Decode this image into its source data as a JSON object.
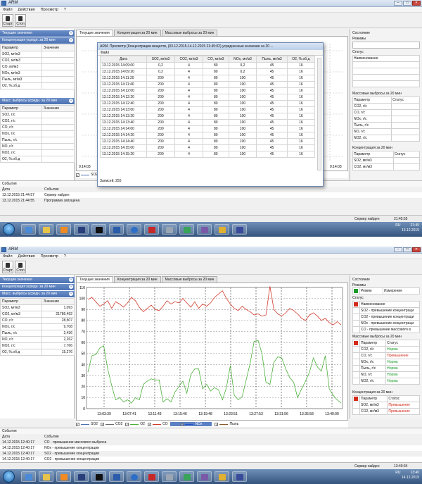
{
  "app": {
    "title": "ARM"
  },
  "menu": [
    "Файл",
    "Действия",
    "Просмотр",
    "?"
  ],
  "toolbar": {
    "start": "Старт",
    "stop": "Стоп"
  },
  "left": {
    "current_values": "Текущие значения",
    "conc_20": "Концентрация усредн. за 20 мин",
    "mass_20": "Масс. выбросы усредн. за 20 мин",
    "param_header": "Параметр",
    "value_header": "Значение"
  },
  "tabs": [
    "Текущие значения",
    "Концентрация за 20 мин",
    "Массовые выбросы за 20 мин"
  ],
  "right": {
    "state": "Состояние",
    "modes": "Режимы",
    "status": "Статус",
    "name_header": "Наименование",
    "mass_20": "Массовые выбросы за 20 мин",
    "conc_20": "Концентрация за 20 мин",
    "param": "Параметр",
    "status_col": "Статус"
  },
  "events": {
    "title": "События",
    "date_col": "Дата",
    "event_col": "Событие"
  },
  "status": {
    "server": "Сервер найден"
  },
  "shot1": {
    "conc_params": [
      "SO2, мг/м3",
      "CO2, мг/м3",
      "CO, мг/м3",
      "NOx, мг/м3",
      "Пыль, мг/м3",
      "O2, %.об.д"
    ],
    "mass_params": [
      "SO2, г/с",
      "CO2, г/с",
      "CO, г/с",
      "NOx, г/с",
      "Пыль, г/с",
      "NO, г/с",
      "NO2, г/с",
      "O2, %.об.д"
    ],
    "right_mass_params": [
      "CO2, г/с",
      "CO, г/с",
      "NOx, г/с",
      "Пыль, г/с",
      "NO, г/с",
      "NO2, г/с"
    ],
    "right_conc_params": [
      "SO2, мг/м3",
      "CO2, мг/м3"
    ],
    "time_left": "0:14:03",
    "time_right": "0:14:03",
    "legend_first": "SO2",
    "events": [
      {
        "date": "13.12.2015 21:44:57",
        "text": "Сервер найден"
      },
      {
        "date": "13.12.2015 21:44:55",
        "text": "Программа запущена"
      }
    ],
    "clock": "21:45:55",
    "tray_time": "21:45",
    "tray_date": "13.12.2015",
    "tray_lang": "RU"
  },
  "dialog": {
    "title": "ARM. Просмотр (Концентрации веществ, (03.12.2015-14.12.2015 21:45:02) усредненные значение за 20 ...",
    "menu": "Файл",
    "columns": [
      "Дата",
      "SO2, мг/м3",
      "CO2, мг/м3",
      "CO, мг/м3",
      "NOx, мг/м3",
      "Пыль, мг/м3",
      "O2, %.об.д"
    ],
    "rows": [
      [
        "13.12.2015 14:09:00",
        "0,2",
        "4",
        "80",
        "0,2",
        "45",
        "16"
      ],
      [
        "13.12.2015 14:09:20",
        "0,2",
        "4",
        "80",
        "0,2",
        "45",
        "16"
      ],
      [
        "13.12.2015 14:11:20",
        "200",
        "4",
        "80",
        "100",
        "45",
        "16"
      ],
      [
        "13.12.2015 14:11:40",
        "200",
        "4",
        "80",
        "100",
        "45",
        "16"
      ],
      [
        "13.12.2015 14:12:00",
        "200",
        "4",
        "80",
        "100",
        "45",
        "16"
      ],
      [
        "13.12.2015 14:12:20",
        "200",
        "4",
        "80",
        "100",
        "45",
        "16"
      ],
      [
        "13.12.2015 14:12:40",
        "200",
        "4",
        "80",
        "100",
        "45",
        "16"
      ],
      [
        "13.12.2015 14:13:00",
        "200",
        "4",
        "80",
        "100",
        "45",
        "16"
      ],
      [
        "13.12.2015 14:13:20",
        "200",
        "4",
        "80",
        "100",
        "45",
        "16"
      ],
      [
        "13.12.2015 14:13:40",
        "200",
        "4",
        "80",
        "100",
        "45",
        "16"
      ],
      [
        "13.12.2015 14:14:00",
        "200",
        "4",
        "80",
        "100",
        "45",
        "16"
      ],
      [
        "13.12.2015 14:14:20",
        "200",
        "4",
        "80",
        "100",
        "45",
        "16"
      ],
      [
        "13.12.2015 14:14:40",
        "200",
        "4",
        "80",
        "100",
        "45",
        "16"
      ],
      [
        "13.12.2015 14:15:00",
        "200",
        "4",
        "80",
        "100",
        "45",
        "16"
      ],
      [
        "13.12.2015 14:15:20",
        "200",
        "4",
        "80",
        "100",
        "45",
        "16"
      ]
    ],
    "records": "Записей: 255"
  },
  "shot2": {
    "current_params": [
      {
        "name": "SO2, мг/м3",
        "value": "1,093"
      },
      {
        "name": "CO2, мг/м3",
        "value": "21786,492"
      },
      {
        "name": "CO, г/с",
        "value": "28,507"
      },
      {
        "name": "NOx, г/с",
        "value": "9,708"
      },
      {
        "name": "Пыль, г/с",
        "value": "2,436"
      },
      {
        "name": "NO, г/с",
        "value": "2,262"
      },
      {
        "name": "NO2, г/с",
        "value": "7,766"
      },
      {
        "name": "O2, %.об.д",
        "value": "15,276"
      }
    ],
    "modes": {
      "mode": "Режим",
      "measure": "Измерение"
    },
    "status_rows": [
      "SO2 - превышение концентраци",
      "CO2 - превышение концентраци",
      "NOx - превышение концентраци",
      "CO - превышение массового в"
    ],
    "right_mass_rows": [
      {
        "name": "CO2, г/с",
        "status": "Норма"
      },
      {
        "name": "CO, г/с",
        "status": "Превышение"
      },
      {
        "name": "NOx, г/с",
        "status": "Норма"
      },
      {
        "name": "Пыль, г/с",
        "status": "Норма"
      },
      {
        "name": "NO, г/с",
        "status": "Норма"
      },
      {
        "name": "NO2, г/с",
        "status": "Норма"
      }
    ],
    "right_conc_rows": [
      {
        "name": "SO2, мг/м3",
        "status": "Превышение"
      },
      {
        "name": "CO2, мг/м3",
        "status": "Превышение"
      }
    ],
    "legend": [
      "SO2",
      "CO2",
      "O2",
      "CO",
      "NOx",
      "Пыль"
    ],
    "events": [
      {
        "date": "14.12.2015 12:40:17",
        "text": "CO - превышение массового выброса"
      },
      {
        "date": "14.12.2015 12:40:17",
        "text": "NOx - превышение концентрации"
      },
      {
        "date": "14.12.2015 12:40:17",
        "text": "SO2 - превышение концентрации"
      },
      {
        "date": "14.12.2015 12:40:17",
        "text": "CO2 - превышение концентрации"
      }
    ],
    "clock": "13:40:34",
    "tray_time": "13:40",
    "tray_date": "14.12.2015",
    "tray_lang": "RU"
  },
  "colors": {
    "accent": "#4a71b3",
    "ok": "#1a9a2a",
    "alarm": "#d42a1a",
    "red_series": "#d23a2a",
    "green_series": "#4caf3a"
  },
  "chart_data": {
    "type": "line",
    "x": [
      "13:03:39",
      "13:07:41",
      "13:11:43",
      "13:15:46",
      "13:19:48",
      "13:23:51",
      "13:27:53",
      "13:31:56",
      "13:35:58",
      "13:40:00"
    ],
    "ylim": [
      0,
      110
    ],
    "yticks": [
      0,
      10,
      20,
      30,
      40,
      50,
      60,
      70,
      80,
      90,
      100,
      110
    ],
    "grid": true,
    "series": [
      {
        "name": "CO",
        "color": "#d23a2a",
        "values": [
          99,
          101,
          97,
          93,
          95,
          98,
          91,
          97,
          95,
          92,
          96,
          101,
          98,
          92,
          88,
          91,
          94,
          90,
          89,
          93,
          98,
          95,
          97,
          96,
          100,
          96,
          92,
          97,
          91,
          95,
          93,
          96,
          101,
          104,
          107,
          100,
          95,
          91,
          89,
          93,
          90,
          88,
          85,
          86,
          84,
          85,
          111,
          90,
          86,
          84,
          87,
          91,
          89,
          86,
          82,
          80,
          85,
          87,
          84,
          80,
          82,
          78,
          76,
          79,
          76
        ]
      },
      {
        "name": "O2",
        "color": "#4caf3a",
        "values": [
          33,
          48,
          49,
          55,
          57,
          36,
          21,
          8,
          10,
          6,
          8,
          5,
          10,
          8,
          22,
          25,
          27,
          26,
          26,
          6,
          9,
          6,
          15,
          20,
          25,
          14,
          31,
          36,
          36,
          18,
          22,
          16,
          19,
          17,
          8,
          19,
          39,
          12,
          8,
          11,
          26,
          41,
          61,
          62,
          50,
          24,
          22,
          42,
          47,
          46,
          36,
          28,
          24,
          10,
          18,
          25,
          33,
          46,
          38,
          34,
          48,
          18,
          12,
          8,
          5
        ]
      }
    ]
  }
}
